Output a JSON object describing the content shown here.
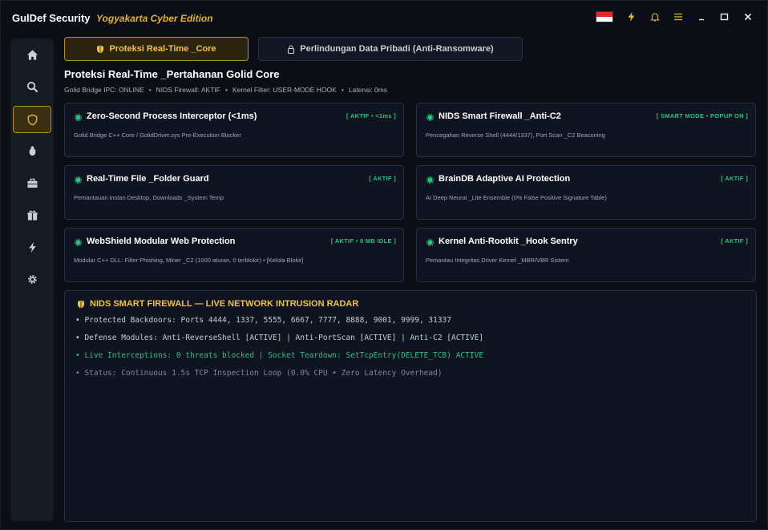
{
  "app": {
    "title": "GulDef Security",
    "subtitle": "Yogyakarta Cyber Edition"
  },
  "titlebar_icons": [
    "indonesia-flag",
    "bolt-icon",
    "bell-icon",
    "menu-icon",
    "minimize-icon",
    "maximize-icon",
    "close-icon"
  ],
  "sidebar": {
    "items": [
      {
        "name": "home-icon"
      },
      {
        "name": "search-icon"
      },
      {
        "name": "shield-icon",
        "active": true
      },
      {
        "name": "bug-icon"
      },
      {
        "name": "briefcase-icon"
      },
      {
        "name": "gift-icon"
      },
      {
        "name": "bolt-icon"
      },
      {
        "name": "gear-icon"
      }
    ]
  },
  "tabs": [
    {
      "label": "Proteksi Real-Time _Core",
      "active": true
    },
    {
      "label": "Perlindungan Data Pribadi (Anti-Ransomware)",
      "active": false
    }
  ],
  "page": {
    "title": "Proteksi Real-Time _Pertahanan Golid Core",
    "status": [
      "Golid Bridge IPC: ONLINE",
      "NIDS Firewall: AKTIF",
      "Kernel Filter: USER-MODE HOOK",
      "Latensi: 0ms"
    ]
  },
  "cards": [
    {
      "title": "Zero-Second Process Interceptor (<1ms)",
      "badge": "[ AKTIF • <1ms ]",
      "desc": "Golid Bridge C++ Core / GolidDriver.sys Pre-Execution Blocker"
    },
    {
      "title": "NIDS Smart Firewall _Anti-C2",
      "badge": "[ SMART MODE • POPUP ON ]",
      "desc": "Pencegahan Reverse Shell (4444/1337), Port Scan _C2 Beaconing"
    },
    {
      "title": "Real-Time File _Folder Guard",
      "badge": "[ AKTIF ]",
      "desc": "Pemantauan instan Desktop, Downloads _System Temp"
    },
    {
      "title": "BrainDB Adaptive AI Protection",
      "badge": "[ AKTIF ]",
      "desc": "AI Deep Neural _Lite Ensemble (0% False Positive Signature Table)"
    },
    {
      "title": "WebShield Modular Web Protection",
      "badge": "[ AKTIF • 0 MB IDLE ]",
      "desc": "Modular C++ DLL: Filter Phishing, Miner _C2 (1000 aturan, 0 terblokir) • [Kelola Blokir]"
    },
    {
      "title": "Kernel Anti-Rootkit _Hook Sentry",
      "badge": "[ AKTIF ]",
      "desc": "Pemantau Integritas Driver Kernel _MBR/VBR Sistem"
    }
  ],
  "radar": {
    "title": "NIDS SMART FIREWALL — LIVE NETWORK INTRUSION RADAR",
    "lines": [
      "• Protected Backdoors: Ports 4444, 1337, 5555, 6667, 7777, 8888, 9001, 9999, 31337",
      "• Defense Modules: Anti-ReverseShell [ACTIVE]  |  Anti-PortScan [ACTIVE]  |  Anti-C2 [ACTIVE]",
      "• Live Interceptions: 0 threats blocked  |  Socket Teardown: SetTcpEntry(DELETE_TCB) ACTIVE",
      "• Status: Continuous 1.5s TCP Inspection Loop (0.0% CPU • Zero Latency Overhead)"
    ]
  },
  "colors": {
    "accent": "#e2b13c",
    "active_green": "#2ec27e",
    "background": "#0b0e14",
    "panel": "#0f1420"
  }
}
